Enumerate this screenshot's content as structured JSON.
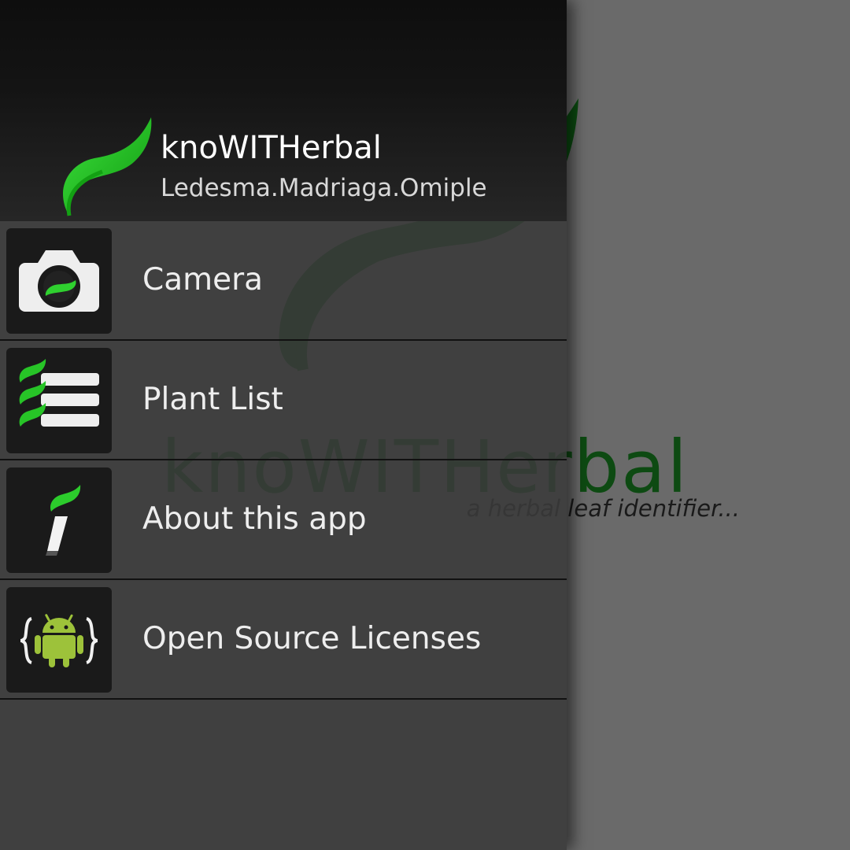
{
  "background": {
    "logo_text": "knoWITHerbal",
    "tagline": "a herbal leaf identifier..."
  },
  "header": {
    "app_name": "knoWITHerbal",
    "subtitle": "Ledesma.Madriaga.Omiple",
    "logo_icon": "leaf-icon"
  },
  "menu": {
    "items": [
      {
        "label": "Camera",
        "icon": "camera-icon"
      },
      {
        "label": "Plant List",
        "icon": "plant-list-icon"
      },
      {
        "label": "About this app",
        "icon": "info-icon"
      },
      {
        "label": "Open Source Licenses",
        "icon": "android-icon"
      }
    ]
  },
  "colors": {
    "accent_green": "#22b822",
    "dark_green": "#0d4a12",
    "android_green": "#9dc23a"
  }
}
